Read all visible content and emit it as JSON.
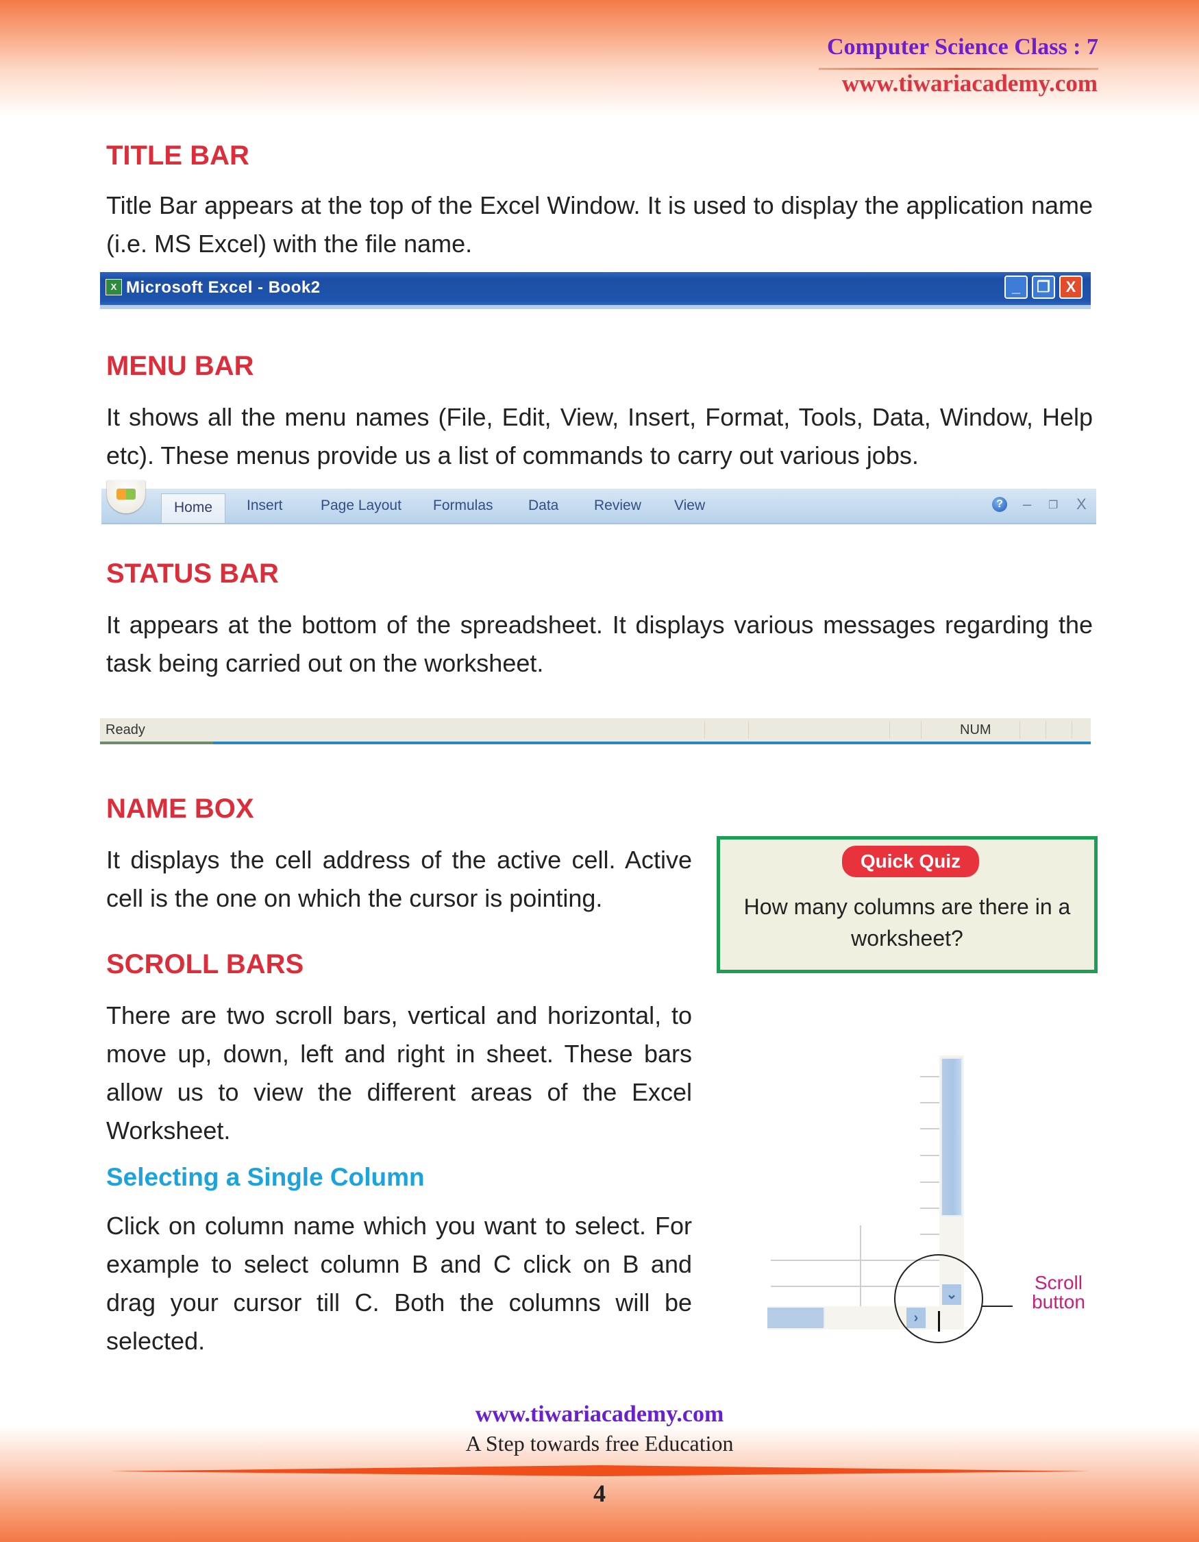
{
  "header": {
    "title": "Computer Science Class : 7",
    "url": "www.tiwariacademy.com"
  },
  "sections": {
    "title_bar": {
      "heading": "TITLE BAR",
      "text": "Title Bar appears at the top of the Excel Window. It is used to display the application name (i.e. MS Excel) with the file name."
    },
    "menu_bar": {
      "heading": "MENU BAR",
      "text": "It shows all the menu names (File, Edit, View, Insert, Format, Tools, Data, Window, Help etc). These menus provide us a list of commands to carry out various jobs."
    },
    "status_bar": {
      "heading": "STATUS BAR",
      "text": "It appears at the bottom of the spreadsheet. It displays various messages regarding the task being carried out on the worksheet."
    },
    "name_box": {
      "heading": "NAME BOX",
      "text": "It displays the cell address of the active cell. Active cell is the one on which the cursor is pointing."
    },
    "scroll_bars": {
      "heading": "SCROLL BARS",
      "text": "There are two scroll bars, vertical and horizontal, to move up, down, left and right in sheet. These bars allow us to view the different areas of the Excel Worksheet."
    },
    "select_column": {
      "heading": "Selecting a Single Column",
      "text": "Click on column name which you want to select. For example to select column B and C click on B and drag your cursor till C. Both the columns will be selected."
    }
  },
  "excel_title_bar": {
    "icon": "excel-icon",
    "title": "Microsoft Excel - Book2",
    "buttons": {
      "minimize": "_",
      "restore": "❐",
      "close": "X"
    }
  },
  "ribbon": {
    "tabs": [
      "Home",
      "Insert",
      "Page Layout",
      "Formulas",
      "Data",
      "Review",
      "View"
    ],
    "active_tab": "Home",
    "controls": {
      "help": "?",
      "minimize": "–",
      "restore": "❐",
      "close": "X"
    }
  },
  "excel_status_bar": {
    "left": "Ready",
    "indicator": "NUM"
  },
  "quiz": {
    "badge": "Quick Quiz",
    "question": "How many columns are there in a worksheet?"
  },
  "scroll_figure": {
    "label": "Scroll button",
    "down_arrow": "⌄",
    "right_arrow": "›"
  },
  "footer": {
    "url": "www.tiwariacademy.com",
    "tagline": "A Step towards free Education",
    "page_number": "4"
  },
  "colors": {
    "heading_red": "#dc2e3a",
    "subheading_blue": "#1aa3dc",
    "header_purple": "#6b1fcf",
    "quiz_border": "#1c9e57",
    "label_magenta": "#c8207a"
  }
}
